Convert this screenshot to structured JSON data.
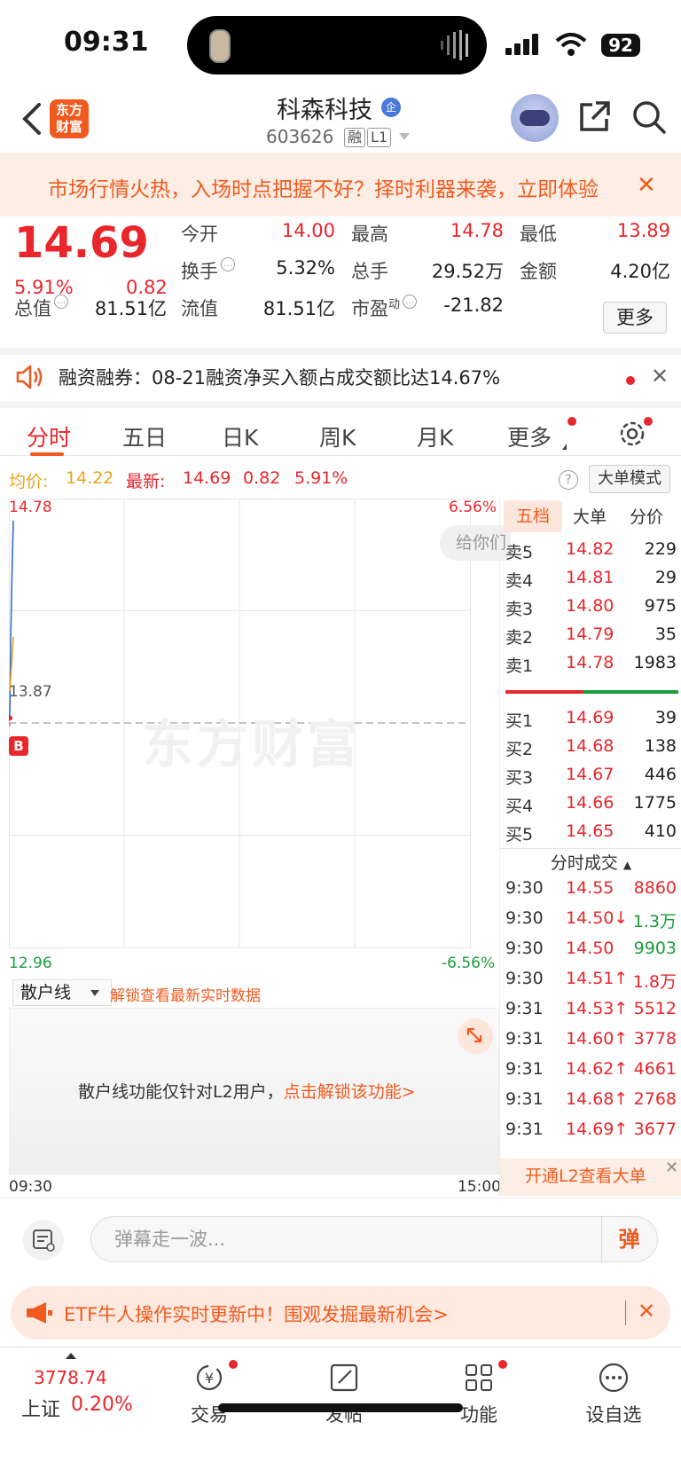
{
  "status_bar": {
    "time": "09:31",
    "battery": "92"
  },
  "header": {
    "logo_text": "东方财富",
    "stock_name": "科森科技",
    "stock_badge": "企",
    "stock_code": "603626",
    "tag_rong": "融",
    "tag_level": "L1"
  },
  "promo": {
    "text": "市场行情火热，入场时点把握不好？择时利器来袭，立即体验"
  },
  "quote": {
    "price": "14.69",
    "pct": "5.91%",
    "change": "0.82",
    "fields": [
      {
        "label": "今开",
        "value": "14.00",
        "color": "red"
      },
      {
        "label": "最高",
        "value": "14.78",
        "color": "red"
      },
      {
        "label": "最低",
        "value": "13.89",
        "color": "red"
      },
      {
        "label": "换手",
        "value": "5.32%",
        "color": "black"
      },
      {
        "label": "总手",
        "value": "29.52万",
        "color": "black"
      },
      {
        "label": "金额",
        "value": "4.20亿",
        "color": "black"
      },
      {
        "label": "总值",
        "value": "81.51亿",
        "color": "black"
      },
      {
        "label": "流值",
        "value": "81.51亿",
        "color": "black"
      },
      {
        "label": "市盈",
        "label_sup": "动",
        "value": "-21.82",
        "color": "black"
      }
    ],
    "more_label": "更多"
  },
  "notice": {
    "text": "融资融券：08-21融资净买入额占成交额比达14.67%"
  },
  "tabs": [
    "分时",
    "五日",
    "日K",
    "周K",
    "月K",
    "更多"
  ],
  "avg_row": {
    "avg_label": "均价:",
    "avg_value": "14.22",
    "last_label": "最新:",
    "last_value": "14.69",
    "last_change": "0.82",
    "last_pct": "5.91%",
    "bigmode_label": "大单模式"
  },
  "chart_data": {
    "type": "line",
    "y_max": 14.78,
    "y_min": 12.96,
    "y_ref": 13.87,
    "pct_top": "6.56%",
    "pct_bottom": "-6.56%",
    "y_max_label": "14.78",
    "y_min_label": "12.96",
    "y_ref_label": "13.87",
    "x_start": "09:30",
    "x_end": "15:00",
    "watermark": "东方财富",
    "series": [
      {
        "values": [
          13.89,
          14.25,
          14.5,
          14.69
        ]
      },
      {
        "values": [
          14.0,
          14.1,
          14.22
        ]
      }
    ],
    "gift_text": "给你们",
    "marker": "B"
  },
  "retail": {
    "select_label": "散户线",
    "unlock_text": "解锁查看最新实时数据",
    "message": "散户线功能仅针对L2用户，",
    "link": "点击解锁该功能>"
  },
  "book": {
    "tabs": [
      "五档",
      "大单",
      "分价"
    ],
    "asks": [
      {
        "label": "卖5",
        "price": "14.82",
        "vol": "229"
      },
      {
        "label": "卖4",
        "price": "14.81",
        "vol": "29"
      },
      {
        "label": "卖3",
        "price": "14.80",
        "vol": "975"
      },
      {
        "label": "卖2",
        "price": "14.79",
        "vol": "35"
      },
      {
        "label": "卖1",
        "price": "14.78",
        "vol": "1983"
      }
    ],
    "bids": [
      {
        "label": "买1",
        "price": "14.69",
        "vol": "39"
      },
      {
        "label": "买2",
        "price": "14.68",
        "vol": "138"
      },
      {
        "label": "买3",
        "price": "14.67",
        "vol": "446"
      },
      {
        "label": "买4",
        "price": "14.66",
        "vol": "1775"
      },
      {
        "label": "买5",
        "price": "14.65",
        "vol": "410"
      }
    ],
    "ticks_header": "分时成交",
    "ticks": [
      {
        "time": "9:30",
        "price": "14.55",
        "vol": "8860",
        "dir": "",
        "pcolor": "red",
        "vcolor": "red"
      },
      {
        "time": "9:30",
        "price": "14.50↓",
        "vol": "1.3万",
        "dir": "down",
        "pcolor": "red",
        "vcolor": "green"
      },
      {
        "time": "9:30",
        "price": "14.50",
        "vol": "9903",
        "dir": "",
        "pcolor": "red",
        "vcolor": "green"
      },
      {
        "time": "9:30",
        "price": "14.51↑",
        "vol": "1.8万",
        "dir": "up",
        "pcolor": "red",
        "vcolor": "red"
      },
      {
        "time": "9:31",
        "price": "14.53↑",
        "vol": "5512",
        "dir": "up",
        "pcolor": "red",
        "vcolor": "red"
      },
      {
        "time": "9:31",
        "price": "14.60↑",
        "vol": "3778",
        "dir": "up",
        "pcolor": "red",
        "vcolor": "red"
      },
      {
        "time": "9:31",
        "price": "14.62↑",
        "vol": "4661",
        "dir": "up",
        "pcolor": "red",
        "vcolor": "red"
      },
      {
        "time": "9:31",
        "price": "14.68↑",
        "vol": "2768",
        "dir": "up",
        "pcolor": "red",
        "vcolor": "red"
      },
      {
        "time": "9:31",
        "price": "14.69↑",
        "vol": "3677",
        "dir": "up",
        "pcolor": "red",
        "vcolor": "red"
      }
    ],
    "l2_label": "开通L2查看大单"
  },
  "danmaku": {
    "placeholder": "弹幕走一波...",
    "send_label": "弹"
  },
  "etf": {
    "text": "ETF牛人操作实时更新中！围观发掘最新机会>"
  },
  "bottom_nav": {
    "index_value": "3778.74",
    "index_name": "上证",
    "index_pct": "0.20%",
    "items": [
      "交易",
      "发帖",
      "功能",
      "设自选"
    ]
  },
  "colors": {
    "red": "#e8262b",
    "green": "#1a9e3a",
    "orange": "#f05a1f",
    "blue": "#2f6ed8",
    "avg": "#e8a51f"
  }
}
